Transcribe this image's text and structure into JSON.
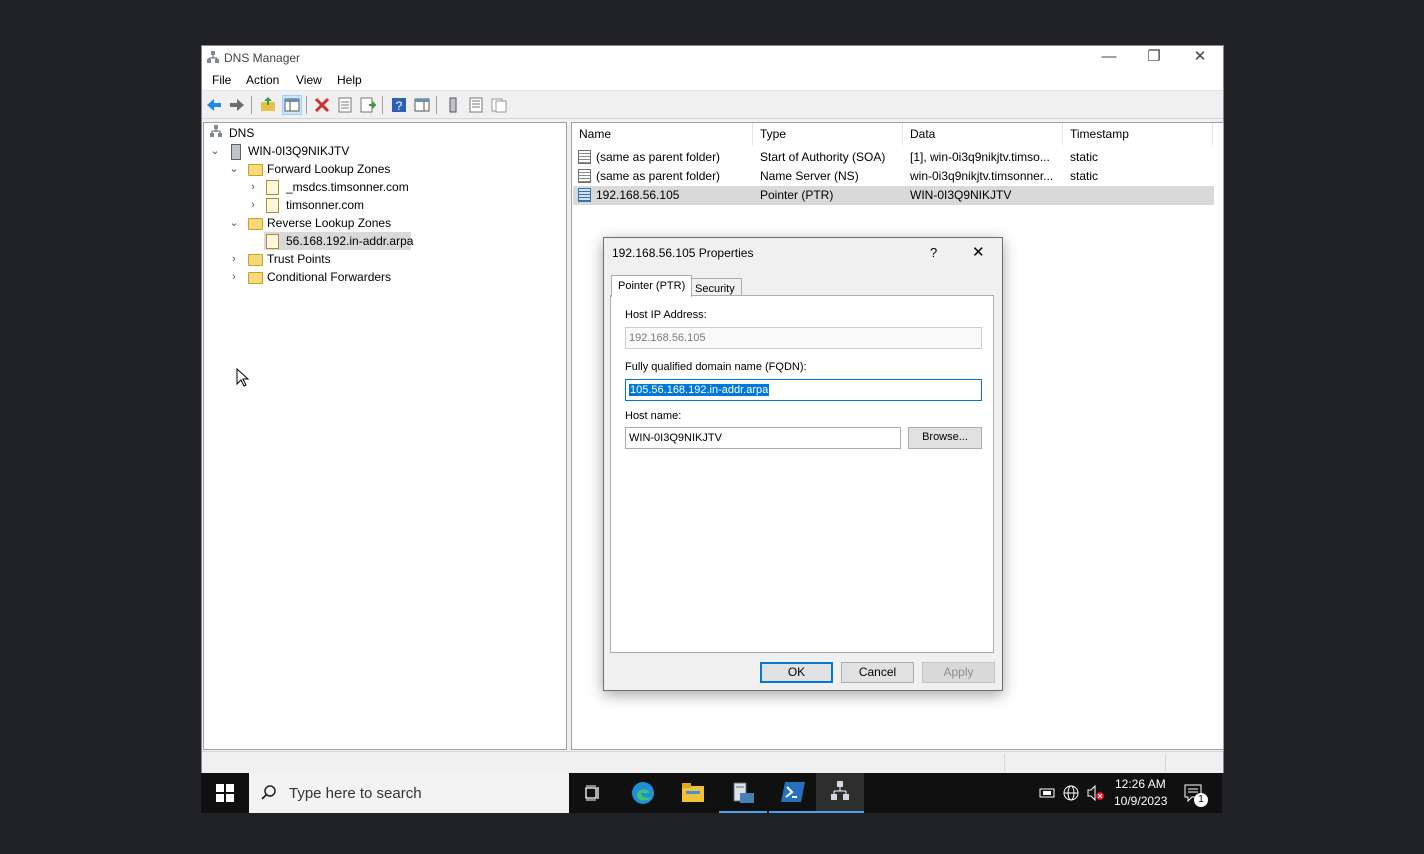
{
  "window": {
    "title": "DNS Manager",
    "controls": {
      "minimize": "—",
      "restore": "❐",
      "close": "✕"
    }
  },
  "menu": [
    "File",
    "Action",
    "View",
    "Help"
  ],
  "toolbar_icons": [
    "back-icon",
    "forward-icon",
    "up-folder-icon",
    "show-hide-tree-icon",
    "delete-icon",
    "properties-icon",
    "export-list-icon",
    "help-icon",
    "show-hide-action-pane-icon",
    "server-icon",
    "list-view-icon",
    "detail-view-icon"
  ],
  "tree": {
    "root": "DNS",
    "server": "WIN-0I3Q9NIKJTV",
    "forward_zones": "Forward Lookup Zones",
    "forward_children": [
      "_msdcs.timsonner.com",
      "timsonner.com"
    ],
    "reverse_zones": "Reverse Lookup Zones",
    "reverse_children": [
      "56.168.192.in-addr.arpa"
    ],
    "trust_points": "Trust Points",
    "conditional_forwarders": "Conditional Forwarders"
  },
  "list": {
    "columns": [
      "Name",
      "Type",
      "Data",
      "Timestamp"
    ],
    "rows": [
      {
        "name": "(same as parent folder)",
        "type": "Start of Authority (SOA)",
        "data": "[1], win-0i3q9nikjtv.timso...",
        "timestamp": "static"
      },
      {
        "name": "(same as parent folder)",
        "type": "Name Server (NS)",
        "data": "win-0i3q9nikjtv.timsonner...",
        "timestamp": "static"
      },
      {
        "name": "192.168.56.105",
        "type": "Pointer (PTR)",
        "data": "WIN-0I3Q9NIKJTV",
        "timestamp": ""
      }
    ]
  },
  "dialog": {
    "title": "192.168.56.105 Properties",
    "help": "?",
    "close": "✕",
    "tabs": [
      "Pointer (PTR)",
      "Security"
    ],
    "host_ip_label": "Host IP Address:",
    "host_ip_value": "192.168.56.105",
    "fqdn_label": "Fully qualified domain name (FQDN):",
    "fqdn_value": "105.56.168.192.in-addr.arpa",
    "host_name_label": "Host name:",
    "host_name_value": "WIN-0I3Q9NIKJTV",
    "browse": "Browse...",
    "ok": "OK",
    "cancel": "Cancel",
    "apply": "Apply"
  },
  "taskbar": {
    "search_placeholder": "Type here to search",
    "time": "12:26 AM",
    "date": "10/9/2023",
    "notification_count": "1"
  },
  "colors": {
    "accent": "#0078d7",
    "selection": "#cce8ff",
    "highlight": "#0078d7",
    "taskbar": "#101010"
  }
}
